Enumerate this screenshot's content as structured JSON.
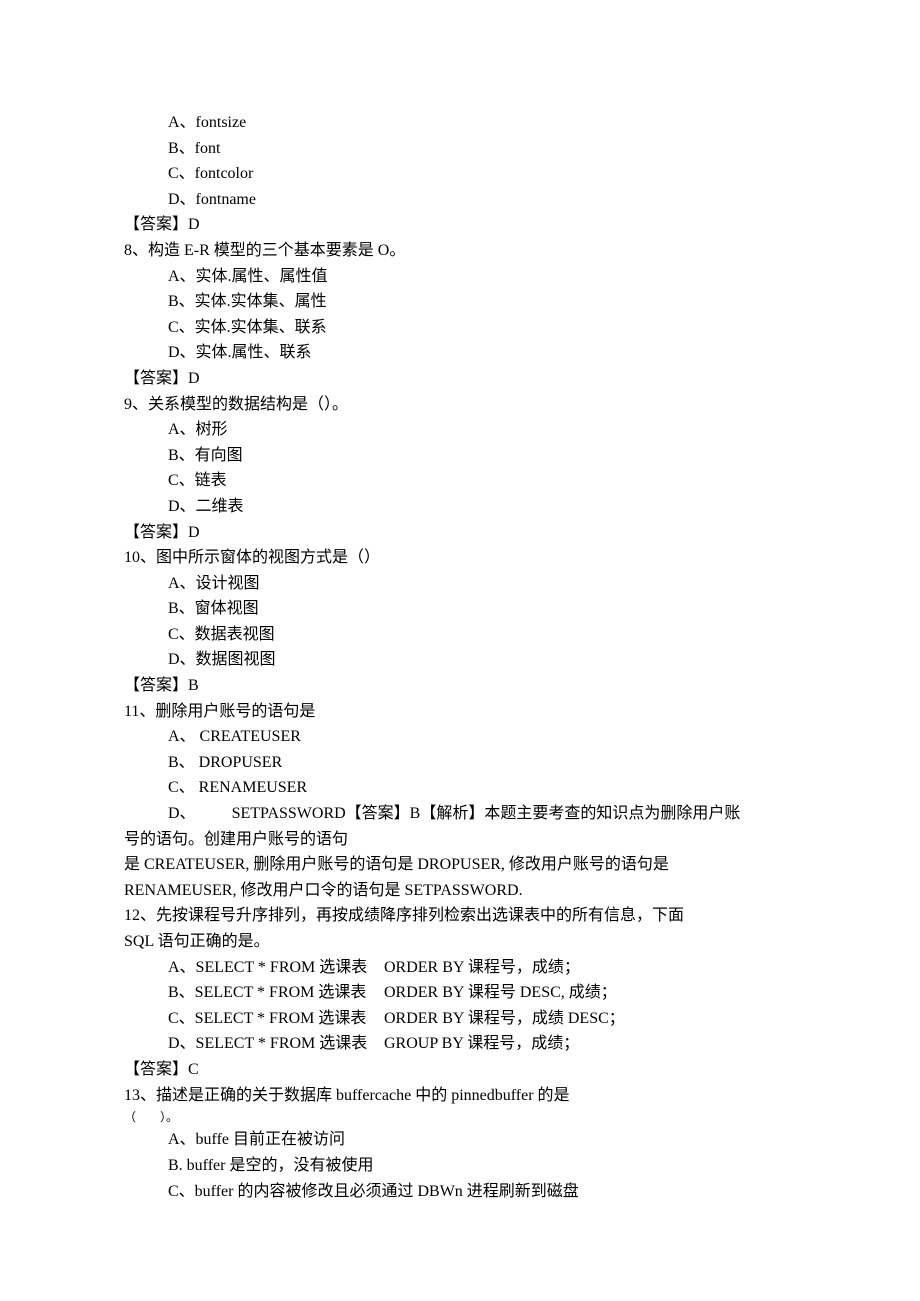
{
  "q7": {
    "options": {
      "A": "A、fontsize",
      "B": "B、font",
      "C": "C、fontcolor",
      "D": "D、fontname"
    },
    "answer": "【答案】D"
  },
  "q8": {
    "stem": "8、构造 E-R 模型的三个基本要素是 O。",
    "options": {
      "A": "A、实体.属性、属性值",
      "B": "B、实体.实体集、属性",
      "C": "C、实体.实体集、联系",
      "D": "D、实体.属性、联系"
    },
    "answer": "【答案】D"
  },
  "q9": {
    "stem": "9、关系模型的数据结构是（）。",
    "options": {
      "A": "A、树形",
      "B": "B、有向图",
      "C": "C、链表",
      "D": "D、二维表"
    },
    "answer": "【答案】D"
  },
  "q10": {
    "stem": "10、图中所示窗体的视图方式是（）",
    "options": {
      "A": "A、设计视图",
      "B": "B、窗体视图",
      "C": "C、数据表视图",
      "D": "D、数据图视图"
    },
    "answer": "【答案】B"
  },
  "q11": {
    "stem": "11、删除用户账号的语句是",
    "options": {
      "A": "A、 CREATEUSER",
      "B": "B、 DROPUSER",
      "C": "C、 RENAMEUSER",
      "D_prefix": "D、",
      "D_body": "SETPASSWORD【答案】B【解析】本题主要考查的知识点为删除用户账"
    },
    "cont1": "号的语句。创建用户账号的语句",
    "cont2": "是 CREATEUSER, 删除用户账号的语句是 DROPUSER, 修改用户账号的语句是",
    "cont3": "RENAMEUSER, 修改用户口令的语句是 SETPASSWORD."
  },
  "q12": {
    "stem1": "12、先按课程号升序排列，再按成绩降序排列检索出选课表中的所有信息，下面",
    "stem2": " SQL 语句正确的是。",
    "rows": {
      "A": {
        "left": "A、SELECT  * FROM 选课表",
        "right": "ORDER BY 课程号，成绩；"
      },
      "B": {
        "left": "B、SELECT  * FROM 选课表",
        "right": "ORDER BY 课程号 DESC, 成绩；"
      },
      "C": {
        "left": "C、SELECT  * FROM 选课表",
        "right": "ORDER BY 课程号，成绩 DESC；"
      },
      "D": {
        "left": "D、SELECT  * FROM 选课表",
        "right": "GROUP BY 课程号，成绩；"
      }
    },
    "answer": "【答案】C"
  },
  "q13": {
    "stem": "13、描述是正确的关于数据库 buffercache 中的 pinnedbuffer 的是",
    "paren": "（　　）。",
    "options": {
      "A": "A、buffe 目前正在被访问",
      "B": "B. buffer 是空的，没有被使用",
      "C": "C、buffer 的内容被修改且必须通过 DBWn 进程刷新到磁盘"
    }
  }
}
